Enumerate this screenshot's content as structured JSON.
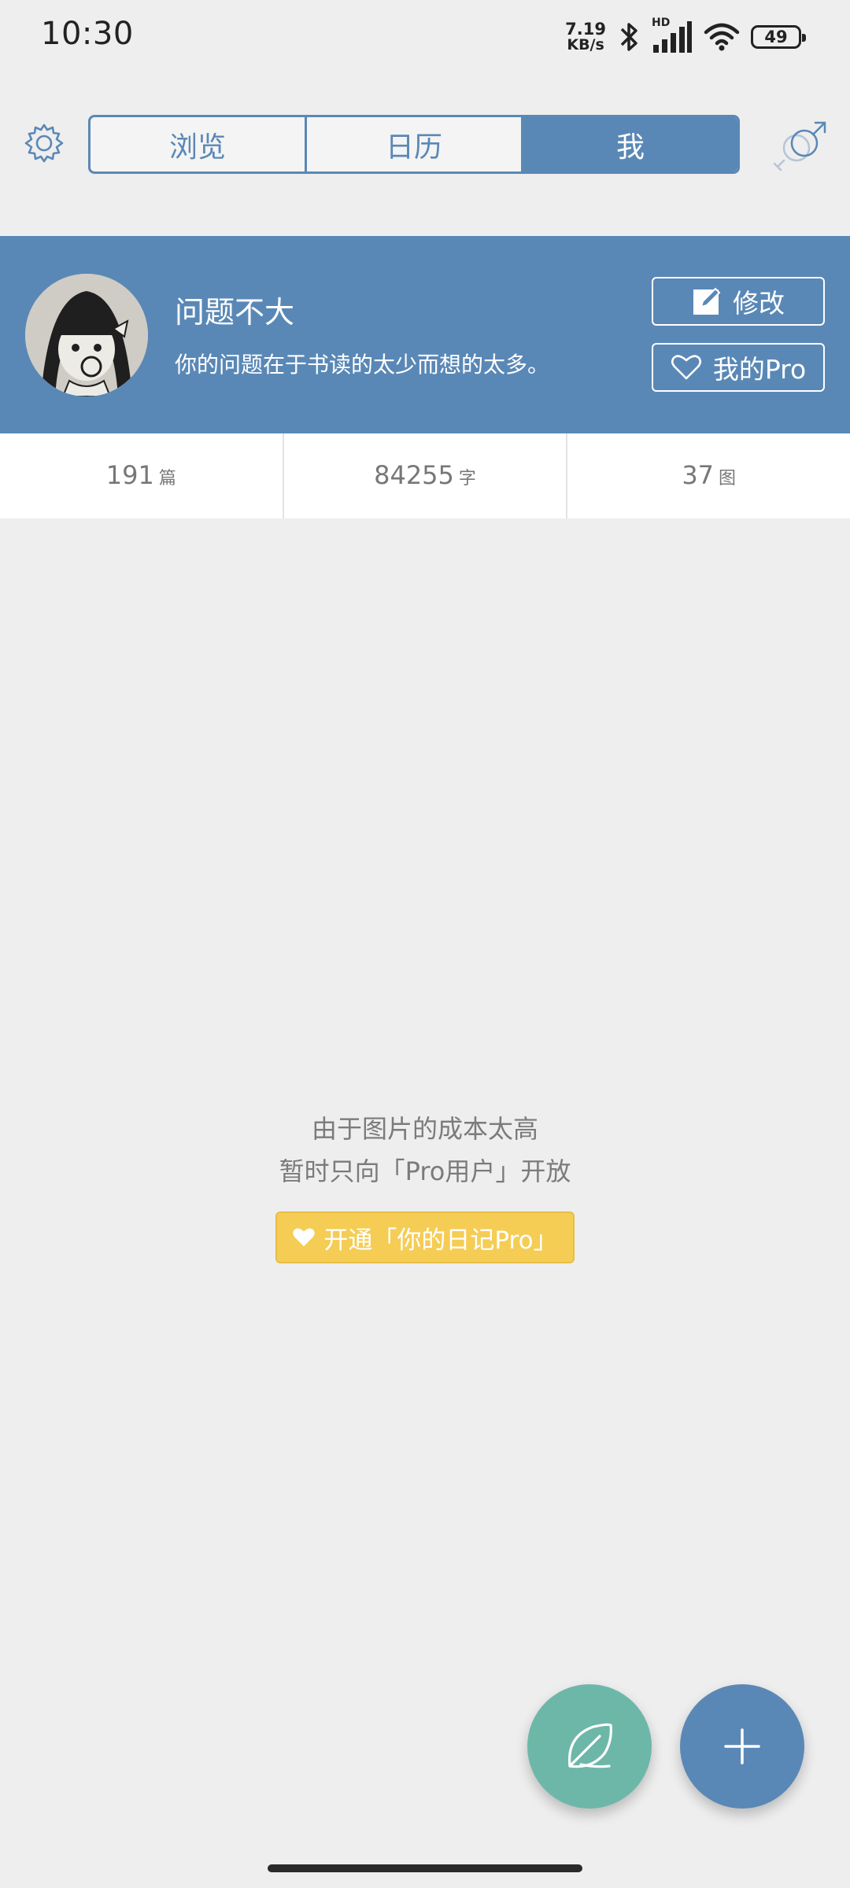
{
  "status_bar": {
    "time": "10:30",
    "net_speed_value": "7.19",
    "net_speed_unit": "KB/s",
    "hd_label": "HD",
    "battery": "49"
  },
  "header": {
    "tabs": [
      {
        "label": "浏览",
        "active": false
      },
      {
        "label": "日历",
        "active": false
      },
      {
        "label": "我",
        "active": true
      }
    ],
    "settings_icon": "gear-icon",
    "gender_icon": "male-female-icon"
  },
  "profile": {
    "name": "问题不大",
    "bio": "你的问题在于书读的太少而想的太多。",
    "edit_label": "修改",
    "pro_label": "我的Pro"
  },
  "stats": [
    {
      "value": "191",
      "unit": "篇"
    },
    {
      "value": "84255",
      "unit": "字"
    },
    {
      "value": "37",
      "unit": "图"
    }
  ],
  "empty_state": {
    "line1": "由于图片的成本太高",
    "line2": "暂时只向「Pro用户」开放",
    "button_label": "开通「你的日记Pro」"
  },
  "colors": {
    "primary": "#5a88b6",
    "background": "#eeeeee",
    "pro_yellow": "#f5cd55",
    "leaf_green": "#6db7a9"
  }
}
